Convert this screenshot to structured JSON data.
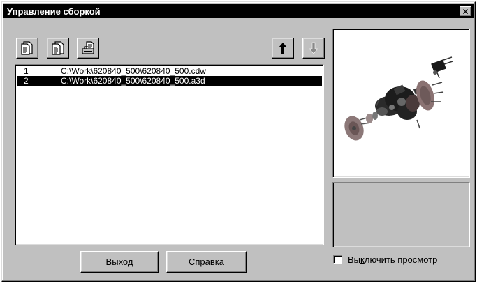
{
  "window": {
    "title": "Управление сборкой",
    "close_glyph": "✕"
  },
  "toolbar": {
    "buttons": [
      {
        "icon": "document-add-icon"
      },
      {
        "icon": "document-replace-icon"
      },
      {
        "icon": "document-print-icon"
      },
      {
        "icon": "arrow-up-icon"
      },
      {
        "icon": "arrow-down-icon",
        "state": "disabled"
      }
    ]
  },
  "file_list": {
    "rows": [
      {
        "num": "1",
        "path": "C:\\Work\\620840_500\\620840_500.cdw",
        "selected": false
      },
      {
        "num": "2",
        "path": "C:\\Work\\620840_500\\620840_500.a3d",
        "selected": true
      }
    ]
  },
  "buttons": {
    "exit_label": "Выход",
    "exit_mnemonic": "В",
    "exit_rest": "ыход",
    "help_label": "Справка",
    "help_mnemonic": "С",
    "help_rest": "правка"
  },
  "preview": {
    "image": "exploded-assembly-render"
  },
  "disable_preview": {
    "label": "Выключить просмотр",
    "label_pre": "Вы",
    "label_mnemonic": "к",
    "label_rest": "лючить просмотр",
    "checked": false
  },
  "colors": {
    "face": "#c0c0c0",
    "titlebar": "#000000",
    "selection": "#000000",
    "disabled_arrow": "#8a8a8a"
  }
}
